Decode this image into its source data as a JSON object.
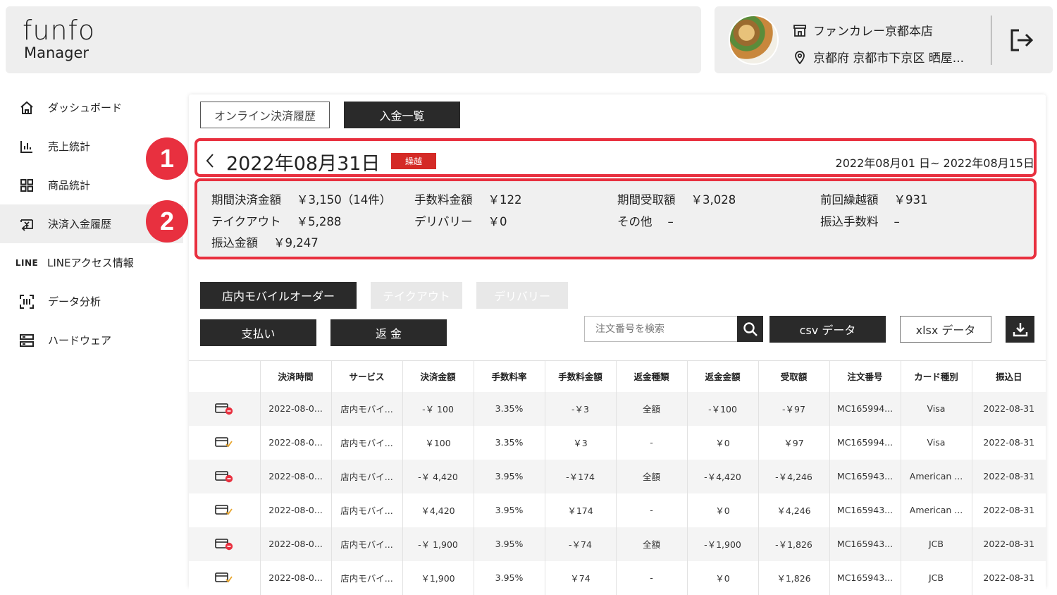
{
  "header": {
    "logo_top": "funfo",
    "logo_bottom": "Manager",
    "store_name": "ファンカレー京都本店",
    "store_address": "京都府 京都市下京区 晒屋..."
  },
  "sidebar": {
    "items": [
      {
        "label": "ダッシュボード",
        "icon": "home-icon"
      },
      {
        "label": "売上統計",
        "icon": "bar-chart-icon"
      },
      {
        "label": "商品統計",
        "icon": "grid-icon"
      },
      {
        "label": "決済入金履歴",
        "icon": "yen-transfer-icon"
      },
      {
        "label": "LINEアクセス情報",
        "icon": "line-icon",
        "icon_text": "LINE"
      },
      {
        "label": "データ分析",
        "icon": "scan-icon"
      },
      {
        "label": "ハードウェア",
        "icon": "server-icon"
      }
    ],
    "active_index": 3
  },
  "tabs": {
    "online_history": "オンライン決済履歴",
    "deposit_list": "入金一覧"
  },
  "deposit": {
    "date": "2022年08月31日",
    "badge": "繰越",
    "period": "2022年08月01 日~ 2022年08月15日"
  },
  "summary": {
    "period_payment_label": "期間決済金額",
    "period_payment_value": "￥3,150（14件）",
    "fee_amount_label": "手数料金額",
    "fee_amount_value": "￥122",
    "period_received_label": "期間受取額",
    "period_received_value": "￥3,028",
    "prev_carry_label": "前回繰越額",
    "prev_carry_value": "￥931",
    "takeout_label": "テイクアウト",
    "takeout_value": "￥5,288",
    "delivery_label": "デリバリー",
    "delivery_value": "￥0",
    "other_label": "その他",
    "other_value": "–",
    "transfer_fee_label": "振込手数料",
    "transfer_fee_value": "–",
    "transfer_amount_label": "振込金額",
    "transfer_amount_value": "￥9,247"
  },
  "annotations": {
    "marker1": "1",
    "marker2": "2"
  },
  "service_tabs": {
    "mobile_order": "店内モバイルオーダー",
    "takeout": "テイクアウト",
    "delivery": "デリバリー"
  },
  "actions": {
    "pay": "支払い",
    "refund": "返 金",
    "search_placeholder": "注文番号を検索",
    "csv": "csv データ",
    "xlsx": "xlsx データ"
  },
  "colors": {
    "highlight_red": "#e8303f",
    "badge_red": "#d42a26",
    "dark": "#2a2a2a"
  },
  "table": {
    "columns": [
      "",
      "決済時間",
      "サービス",
      "決済金額",
      "手数料率",
      "手数料金額",
      "返金種類",
      "返金金額",
      "受取額",
      "注文番号",
      "カード種別",
      "振込日"
    ],
    "rows": [
      {
        "icon": "card-refund-icon",
        "time": "2022-08-0...",
        "service": "店内モバイ...",
        "amount": "-￥ 100",
        "rate": "3.35%",
        "fee": "-￥3",
        "refund_type": "全額",
        "refund_amount": "-￥100",
        "received": "-￥97",
        "order": "MC165994...",
        "card": "Visa",
        "transfer_date": "2022-08-31"
      },
      {
        "icon": "card-check-icon",
        "time": "2022-08-0...",
        "service": "店内モバイ...",
        "amount": "￥100",
        "rate": "3.35%",
        "fee": "￥3",
        "refund_type": "-",
        "refund_amount": "￥0",
        "received": "￥97",
        "order": "MC165994...",
        "card": "Visa",
        "transfer_date": "2022-08-31"
      },
      {
        "icon": "card-refund-icon",
        "time": "2022-08-0...",
        "service": "店内モバイ...",
        "amount": "-￥ 4,420",
        "rate": "3.95%",
        "fee": "-￥174",
        "refund_type": "全額",
        "refund_amount": "-￥4,420",
        "received": "-￥4,246",
        "order": "MC165943...",
        "card": "American ...",
        "transfer_date": "2022-08-31"
      },
      {
        "icon": "card-check-icon",
        "time": "2022-08-0...",
        "service": "店内モバイ...",
        "amount": "￥4,420",
        "rate": "3.95%",
        "fee": "￥174",
        "refund_type": "-",
        "refund_amount": "￥0",
        "received": "￥4,246",
        "order": "MC165943...",
        "card": "American ...",
        "transfer_date": "2022-08-31"
      },
      {
        "icon": "card-refund-icon",
        "time": "2022-08-0...",
        "service": "店内モバイ...",
        "amount": "-￥ 1,900",
        "rate": "3.95%",
        "fee": "-￥74",
        "refund_type": "全額",
        "refund_amount": "-￥1,900",
        "received": "-￥1,826",
        "order": "MC165943...",
        "card": "JCB",
        "transfer_date": "2022-08-31"
      },
      {
        "icon": "card-check-icon",
        "time": "2022-08-0...",
        "service": "店内モバイ...",
        "amount": "￥1,900",
        "rate": "3.95%",
        "fee": "￥74",
        "refund_type": "-",
        "refund_amount": "￥0",
        "received": "￥1,826",
        "order": "MC165943...",
        "card": "JCB",
        "transfer_date": "2022-08-31"
      }
    ]
  }
}
